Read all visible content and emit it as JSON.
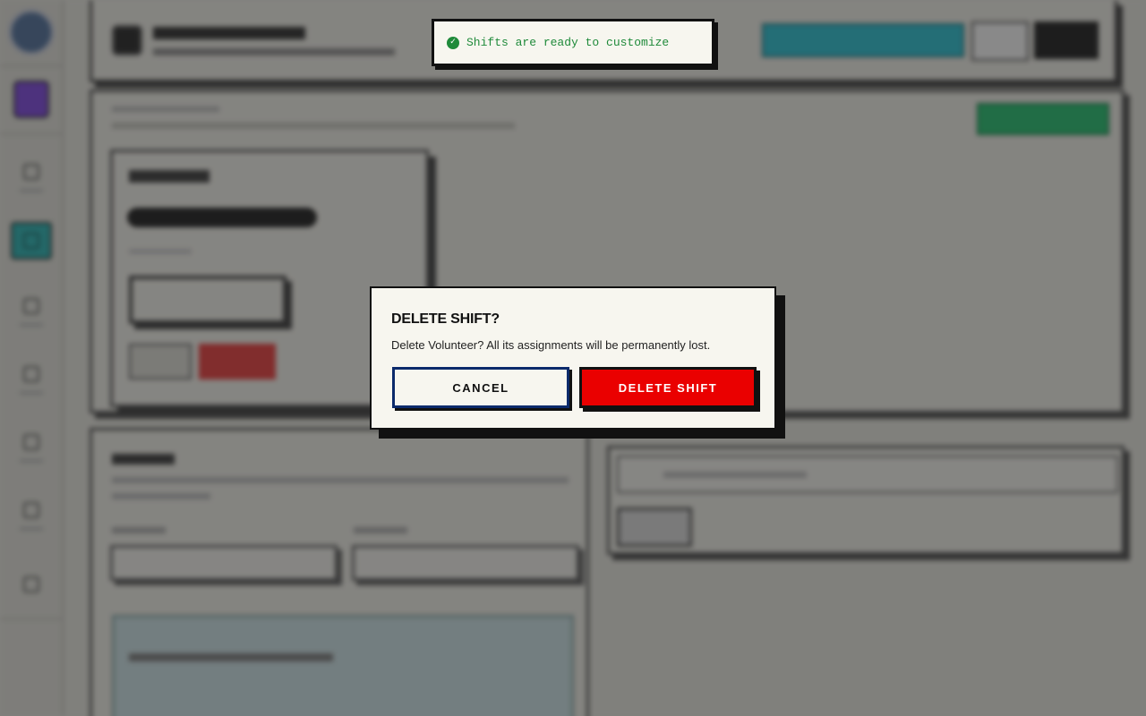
{
  "toast": {
    "icon": "check-circle-icon",
    "message": "Shifts are ready to customize",
    "color": "#1f8a3a"
  },
  "dialog": {
    "title": "DELETE SHIFT?",
    "message": "Delete Volunteer? All its assignments will be permanently lost.",
    "cancel_label": "CANCEL",
    "confirm_label": "DELETE SHIFT",
    "confirm_color": "#ea0000"
  },
  "colors": {
    "accent_cyan": "#21c3d6",
    "accent_green": "#19c26a",
    "accent_purple": "#7b3fe4",
    "backdrop": "rgba(40,40,40,0.55)"
  }
}
